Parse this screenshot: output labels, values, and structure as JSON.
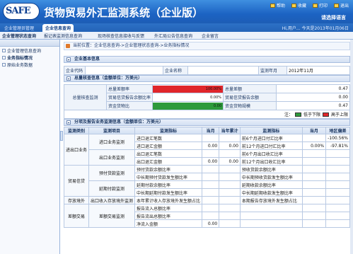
{
  "header": {
    "logo_text": "SAFE",
    "title": "货物贸易外汇监测系统（企业版）",
    "links": [
      "帮助",
      "收藏",
      "打印",
      "退出"
    ],
    "lang": "请选择语言"
  },
  "tabs": {
    "inactive": "企业管理员管理",
    "active": "企业信息查询",
    "clock": "Hi,用户... 今天是2013年01月06日"
  },
  "menubar": {
    "items": [
      "企业管理状态查询",
      "报记表监测信息查询",
      "现场核查信息接收与反馈",
      "外汇局公告信息查询",
      "企业留言"
    ]
  },
  "sidebar": {
    "items": [
      {
        "label": "企业管理信息查询",
        "bold": false
      },
      {
        "label": "业务指标情况",
        "bold": true
      },
      {
        "label": "原始业务数据",
        "bold": false
      }
    ]
  },
  "breadcrumb": "当前位置：企业信息查询->企业管理状态查询->业务指标情况",
  "sections": {
    "basic": "企业基本信息",
    "overall": "总量核查信息（金额单位：万美元）",
    "detail": "分项及报告业务监测信息（金额单位：万美元）"
  },
  "basic_info": {
    "code_label": "企业代码",
    "code_value": "",
    "name_label": "企业名称",
    "name_value": "",
    "period_label": "监测年月",
    "period_value": "2012年11月"
  },
  "overall": {
    "group_label": "总量核查监测",
    "rows": [
      {
        "l": "总量差额率",
        "v": "100.00%",
        "color": "#e0262a",
        "fill": 1.0,
        "r": "总量差额",
        "rv": "0.47"
      },
      {
        "l": "贸易信贷报告余额比率",
        "v": "0.00%",
        "color": "#ffffff",
        "fill": 0.0,
        "r": "贸易信贷报告余额",
        "rv": "0.00"
      },
      {
        "l": "资金货物比",
        "v": "0.00",
        "color": "#2e9a3b",
        "fill": 1.0,
        "r": "资金货物规模",
        "rv": "0.47"
      }
    ],
    "legend_note": "注：",
    "legend": [
      {
        "label": "低于下限",
        "color": "#2e9a3b"
      },
      {
        "label": "高于上限",
        "color": "#e0262a"
      }
    ]
  },
  "detail_table": {
    "headers": [
      "监测类别",
      "监测项目",
      "监测指标",
      "当月",
      "当年累计",
      "监测指标",
      "当月",
      "地区偏差"
    ],
    "rows": [
      {
        "cat": "进出口业务",
        "item": "进口业务监测",
        "ind": "进口退汇笔数",
        "cur": "",
        "ytd": "",
        "ind2": "前6个月进口付汇比率",
        "cur2": "",
        "dev": "-100.56%"
      },
      {
        "cat": "",
        "item": "",
        "ind": "进口退汇金额",
        "cur": "0.00",
        "ytd": "0.00",
        "ind2": "前12个月进口付汇比率",
        "cur2": "0.00%",
        "dev": "-97.81%"
      },
      {
        "cat": "",
        "item": "出口业务监测",
        "ind": "出口退汇笔数",
        "cur": "",
        "ytd": "",
        "ind2": "前6个月出口收汇比率",
        "cur2": "",
        "dev": ""
      },
      {
        "cat": "",
        "item": "",
        "ind": "出口退汇金额",
        "cur": "0.00",
        "ytd": "0.00",
        "ind2": "前12个月出口收汇比率",
        "cur2": "",
        "dev": ""
      },
      {
        "cat": "贸易信贷",
        "item": "预付货款监测",
        "ind": "预付货款余额比率",
        "cur": "",
        "ytd": "",
        "ind2": "预收货款余额比率",
        "cur2": "",
        "dev": ""
      },
      {
        "cat": "",
        "item": "",
        "ind": "中长期预付货款发生额比率",
        "cur": "",
        "ytd": "",
        "ind2": "中长期预收货款发生额比率",
        "cur2": "",
        "dev": ""
      },
      {
        "cat": "",
        "item": "延期付款监测",
        "ind": "延期付款余额比率",
        "cur": "",
        "ytd": "",
        "ind2": "延期收款余额比率",
        "cur2": "",
        "dev": ""
      },
      {
        "cat": "",
        "item": "",
        "ind": "中长期延期付款发生额比率",
        "cur": "",
        "ytd": "",
        "ind2": "中长期延期收款发生额比率",
        "cur2": "",
        "dev": ""
      },
      {
        "cat": "存放境外",
        "item": "出口收入存放境外监测",
        "ind": "本年累计收入存放境外发生额占比",
        "cur": "",
        "ytd": "",
        "ind2": "本期报告存放境外发生额占比",
        "cur2": "",
        "dev": ""
      },
      {
        "cat": "差额交易",
        "item": "差额交易监测",
        "ind": "报告流入总额比率",
        "cur": "",
        "ytd": "",
        "ind2": "",
        "cur2": "",
        "dev": ""
      },
      {
        "cat": "",
        "item": "",
        "ind": "报告流出总额比率",
        "cur": "",
        "ytd": "",
        "ind2": "",
        "cur2": "",
        "dev": ""
      },
      {
        "cat": "",
        "item": "",
        "ind": "净流入金额",
        "cur": "0.00",
        "ytd": "",
        "ind2": "",
        "cur2": "",
        "dev": ""
      }
    ]
  }
}
